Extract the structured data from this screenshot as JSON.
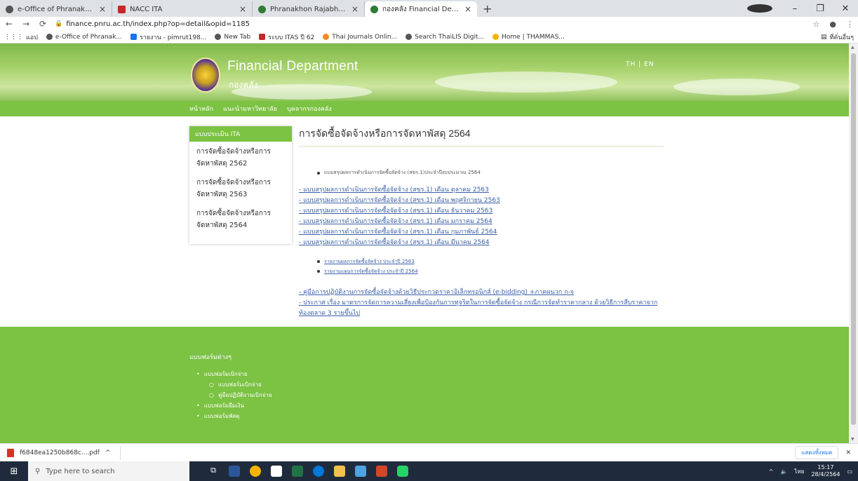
{
  "tabs": [
    {
      "label": "e-Office of Phranakhon Rajabhat",
      "icon": "globe-icon"
    },
    {
      "label": "NACC ITA",
      "icon": "nacc-icon"
    },
    {
      "label": "Phranakhon Rajabhat University",
      "icon": "globe-icon"
    },
    {
      "label": "กองคลัง Financial Department",
      "icon": "globe-icon",
      "active": true
    }
  ],
  "address": {
    "url": "finance.pnru.ac.th/index.php?op=detail&opid=1185"
  },
  "bookmarks": [
    "แอป",
    "e-Office of Phranak...",
    "รายงาน - pimrut198...",
    "New Tab",
    "ระบบ ITAS ปี 62",
    "Thai Journals Onlin...",
    "Search ThaiLIS Digit...",
    "Home | THAMMAS..."
  ],
  "bookmarks_right": "ที่คั่นอื่นๆ",
  "site": {
    "title": "Financial Department",
    "subtitle": "กองคลัง",
    "lang": "TH | EN",
    "nav": [
      "หน้าหลัก",
      "แนะนำมหาวิทยาลัย",
      "บุคลากรกองคลัง"
    ]
  },
  "sidebar": {
    "heading": "แบบประเมิน ITA",
    "items": [
      "การจัดซื้อจัดจ้างหรือการจัดหาพัสดุ 2562",
      "การจัดซื้อจัดจ้างหรือการจัดหาพัสดุ 2563",
      "การจัดซื้อจัดจ้างหรือการจัดหาพัสดุ 2564"
    ]
  },
  "content": {
    "title": "การจัดซื้อจัดจ้างหรือการจัดหาพัสดุ 2564",
    "intro_bullet": "แบบสรุปผลการดำเนินการจัดซื้อจัดจ้าง (สขร.1)ประจำปีงบประมาณ 2564",
    "monthly_links": [
      "- แบบสรุปผลการดำเนินการจัดซื้อจัดจ้าง (สขร.1) เดือน ตุลาคม 2563",
      "- แบบสรุปผลการดำเนินการจัดซื้อจัดจ้าง (สขร.1) เดือน พฤศจิกายน 2563",
      "- แบบสรุปผลการดำเนินการจัดซื้อจัดจ้าง (สขร.1) เดือน ธันวาคม 2563",
      "- แบบสรุปผลการดำเนินการจัดซื้อจัดจ้าง (สขร.1) เดือน มกราคม 2564",
      "- แบบสรุปผลการดำเนินการจัดซื้อจัดจ้าง (สขร.1) เดือน กุมภาพันธ์ 2564",
      "- แบบสรุปผลการดำเนินการจัดซื้อจัดจ้าง (สขร.1) เดือน มีนาคม 2564"
    ],
    "report_links": [
      "รายงานผลการจัดซื้อจัดจ้าง ประจำปี 2563",
      "รายงานแผนการจัดซื้อจัดจ้าง ประจำปี 2564"
    ],
    "manual_link": "- คู่มือการปฏิบัติงานการจัดซื้อจัดจ้างด้วยวิธีประกวดราคาอิเล็กทรอนิกส์ (e-bidding) +ภาคผนวก ก-จ",
    "announcement_link": "- ประกาศ เรื่อง มาตรการจัดการความเสี่ยงเพื่อป้องกันการทุจริตในการจัดซื้อจัดจ้าง กรณีการจัดทำราคากลาง ด้วยวิธีการสืบราคาจากท้องตลาด 3 รายขึ้นไป"
  },
  "footer": {
    "title": "แบบฟอร์มต่างๆ",
    "items": [
      "แบบฟอร์มเบิกจ่าย",
      "แบบฟอร์มยืมเงิน",
      "แบบฟอร์มพัสดุ"
    ],
    "sub_items": [
      "แบบฟอร์มเบิกจ่าย",
      "คู่มือปฏิบัติงานเบิกจ่าย"
    ]
  },
  "download": {
    "file": "f6848ea1250b868c....pdf",
    "show_all": "แสดงทั้งหมด"
  },
  "taskbar": {
    "search_placeholder": "Type here to search",
    "time": "15:17",
    "date": "28/4/2564",
    "lang": "ไทย"
  }
}
